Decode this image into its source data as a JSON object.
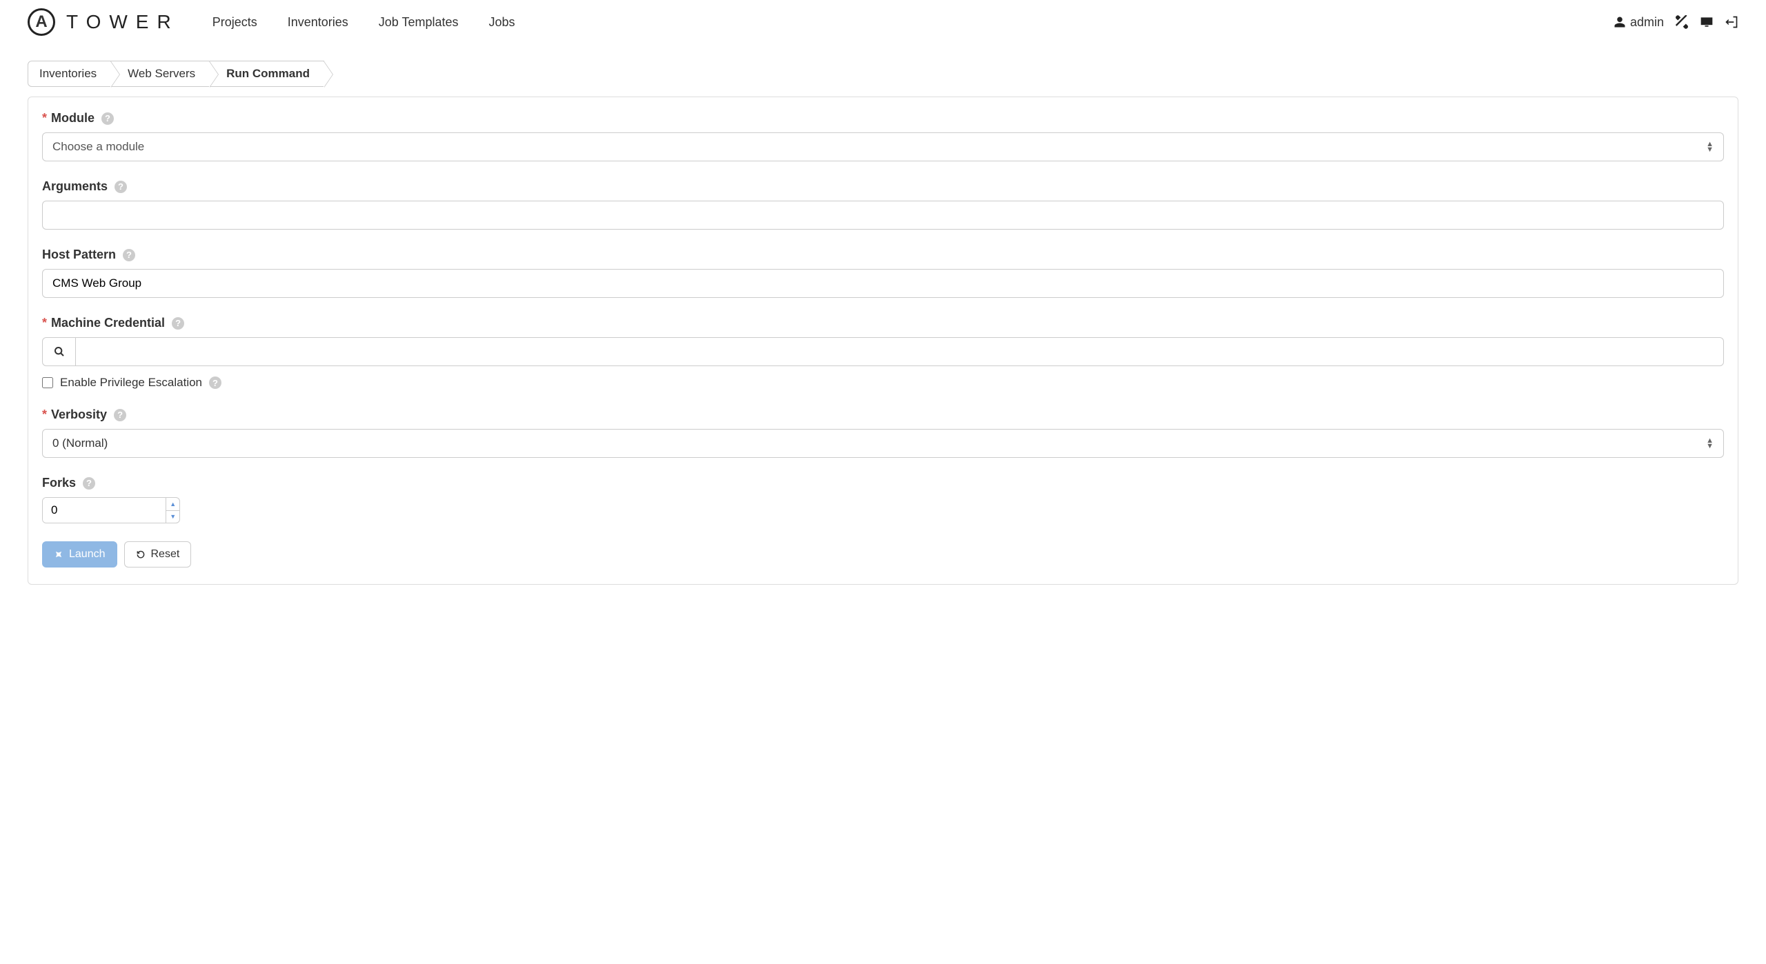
{
  "header": {
    "brand": "TOWER",
    "nav": [
      "Projects",
      "Inventories",
      "Job Templates",
      "Jobs"
    ],
    "user": "admin"
  },
  "breadcrumb": [
    "Inventories",
    "Web Servers",
    "Run Command"
  ],
  "form": {
    "module": {
      "label": "Module",
      "required": true,
      "placeholder": "Choose a module"
    },
    "arguments": {
      "label": "Arguments",
      "required": false,
      "value": ""
    },
    "host_pattern": {
      "label": "Host Pattern",
      "required": false,
      "value": "CMS Web Group"
    },
    "machine_credential": {
      "label": "Machine Credential",
      "required": true,
      "value": ""
    },
    "privilege_escalation": {
      "label": "Enable Privilege Escalation",
      "checked": false
    },
    "verbosity": {
      "label": "Verbosity",
      "required": true,
      "value": "0 (Normal)"
    },
    "forks": {
      "label": "Forks",
      "required": false,
      "value": "0"
    }
  },
  "actions": {
    "launch": "Launch",
    "reset": "Reset"
  }
}
